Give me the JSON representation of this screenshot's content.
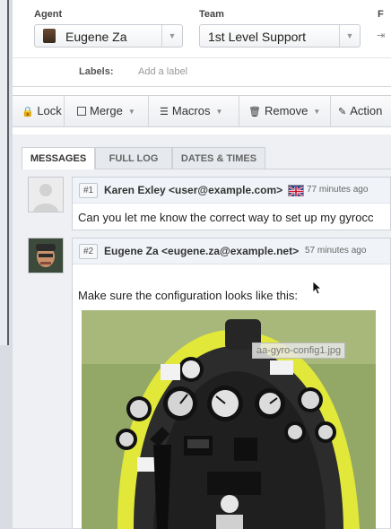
{
  "properties": {
    "agent_label": "Agent",
    "agent_value": "Eugene Za",
    "team_label": "Team",
    "team_value": "1st Level Support",
    "third_label_fragment": "F",
    "labels_label": "Labels:",
    "labels_placeholder": "Add a label"
  },
  "toolbar": {
    "lock": "Lock",
    "merge": "Merge",
    "macros": "Macros",
    "remove": "Remove",
    "actions": "Action"
  },
  "tabs": [
    {
      "label": "MESSAGES",
      "active": true
    },
    {
      "label": "FULL LOG",
      "active": false
    },
    {
      "label": "DATES & TIMES",
      "active": false
    }
  ],
  "messages": [
    {
      "number": "#1",
      "from": "Karen Exley <user@example.com>",
      "time": "77 minutes ago",
      "body": "Can you let me know the correct way to set up my gyrocc"
    },
    {
      "number": "#2",
      "from": "Eugene Za <eugene.za@example.net>",
      "time": "57 minutes ago",
      "body": "Make sure the configuration looks like this:",
      "attachment_caption": "aa-gyro-config1.jpg"
    }
  ],
  "colors": {
    "accent_link": "#333333",
    "photo_frame_yellow": "#d9e23a",
    "panel_dark": "#2b2b2b"
  }
}
